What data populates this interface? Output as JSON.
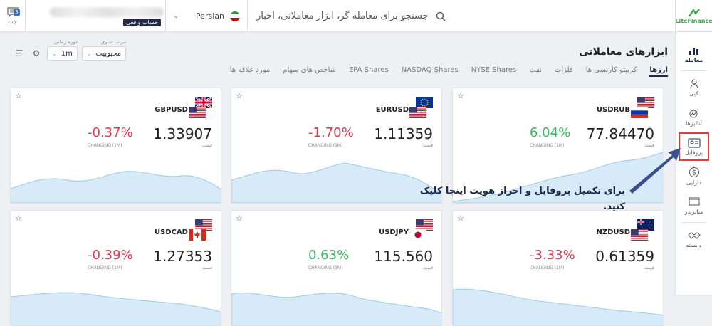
{
  "topbar": {
    "chat_label": "چت",
    "chat_badge": "3",
    "account_badge": "حساب واقعی",
    "language": "Persian",
    "search_placeholder": "جستجو برای معامله گر، ابزار معاملاتی، اخبار",
    "logo_text": "LiteFinance"
  },
  "sidebar": {
    "items": [
      {
        "label": "معامله"
      },
      {
        "label": "کپی"
      },
      {
        "label": "آنالیزها"
      },
      {
        "label": "پروفایل"
      },
      {
        "label": "دارایی"
      },
      {
        "label": "متاتریدر"
      },
      {
        "label": "وابسته"
      }
    ]
  },
  "main": {
    "title": "ابزارهای معاملاتی",
    "tabs": [
      "ارزها",
      "کریپتو کارنسی ها",
      "فلزات",
      "نفت",
      "NYSE Shares",
      "NASDAQ Shares",
      "EPA Shares",
      "شاخص های سهام",
      "مورد علاقه ها"
    ],
    "filters": {
      "sort_label": "مرتب سازی",
      "sort_value": "محبوبیت",
      "period_label": "دوره زمانی",
      "period_value": "1m"
    },
    "price_label": "قیمت",
    "change_label": "CHANGING (1M)"
  },
  "cards": [
    {
      "symbol": "GBPUSD",
      "price": "1.33907",
      "change": "-0.37%",
      "dir": "neg",
      "flag_top": "gb",
      "flag_bottom": "us"
    },
    {
      "symbol": "EURUSD",
      "price": "1.11359",
      "change": "-1.70%",
      "dir": "neg",
      "flag_top": "eu",
      "flag_bottom": "us"
    },
    {
      "symbol": "USDRUB",
      "price": "77.84470",
      "change": "6.04%",
      "dir": "pos",
      "flag_top": "us",
      "flag_bottom": "ru"
    },
    {
      "symbol": "USDCAD",
      "price": "1.27353",
      "change": "-0.39%",
      "dir": "neg",
      "flag_top": "us",
      "flag_bottom": "ca"
    },
    {
      "symbol": "USDJPY",
      "price": "115.560",
      "change": "0.63%",
      "dir": "pos",
      "flag_top": "us",
      "flag_bottom": "jp"
    },
    {
      "symbol": "NZDUSD",
      "price": "0.61359",
      "change": "-3.33%",
      "dir": "neg",
      "flag_top": "nz",
      "flag_bottom": "us"
    }
  ],
  "overlay": {
    "text": "برای تکمیل پروفایل و احراز هویت اینجا کلیک کنید."
  },
  "colors": {
    "negative": "#e53950",
    "positive": "#3ab860",
    "area_fill": "#d6eaf8",
    "area_stroke": "#9ccbea",
    "highlight": "#e53935",
    "accent": "#1b2a4a"
  }
}
